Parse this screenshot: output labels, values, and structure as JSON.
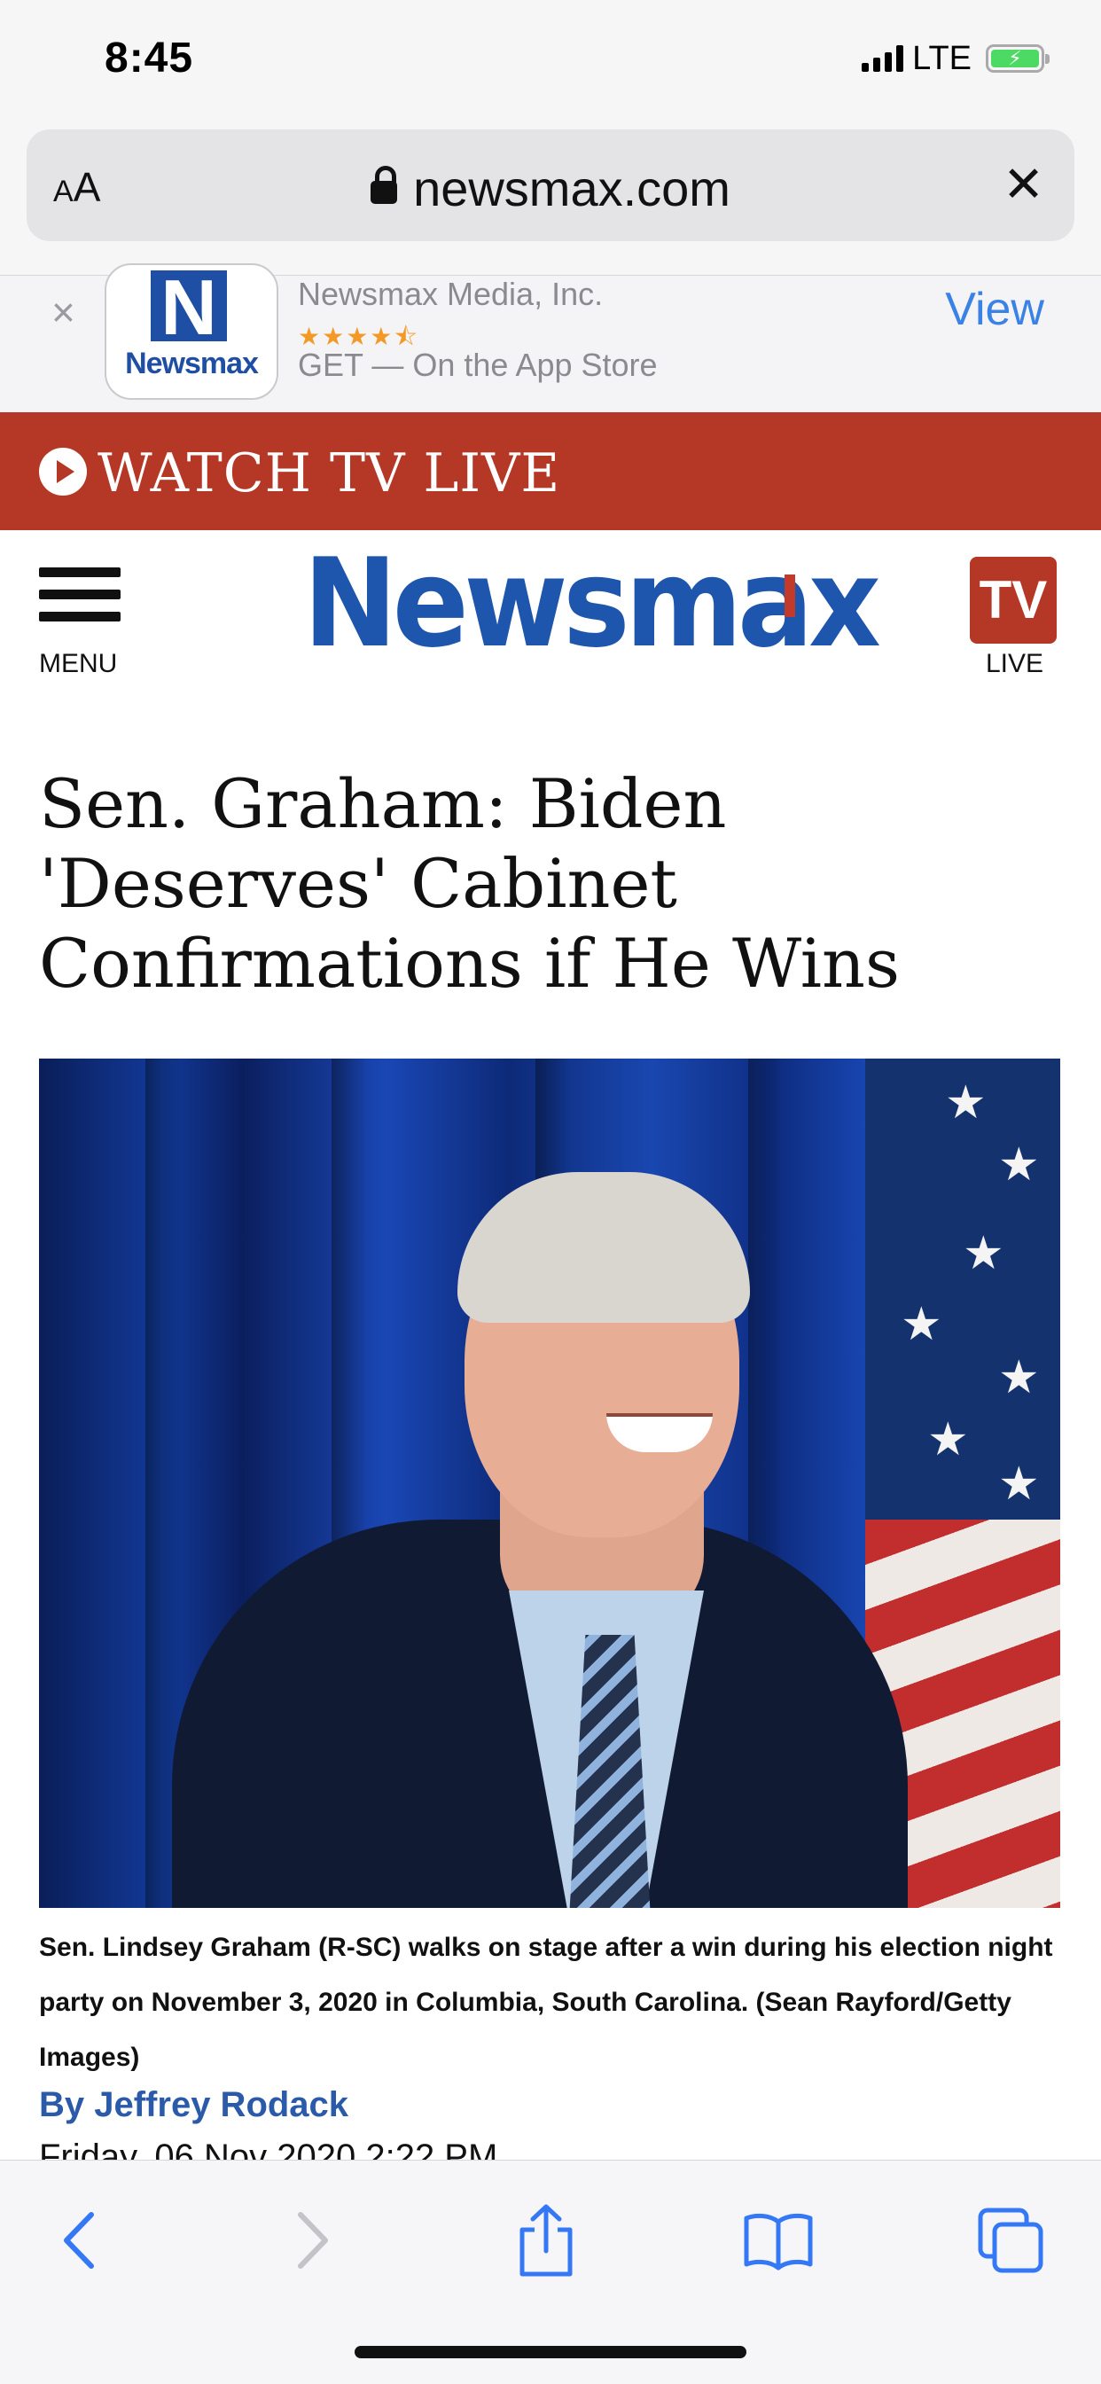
{
  "status_bar": {
    "time": "8:45",
    "network": "LTE"
  },
  "browser": {
    "text_size_label": "AA",
    "domain": "newsmax.com"
  },
  "app_banner": {
    "app_name": "Newsmax Media, Inc.",
    "rating_stars": "★★★★⯪",
    "get_text": "GET — On the App Store",
    "view_label": "View",
    "logo_letter": "N",
    "logo_word": "Newsmax"
  },
  "watch_bar": {
    "label": "WATCH TV LIVE",
    "color": "#b53826"
  },
  "site_header": {
    "menu_label": "MENU",
    "logo_text": "Newsmax",
    "tv_badge": "TV",
    "live_label": "LIVE",
    "brand_color": "#1e55ad"
  },
  "article": {
    "headline": "Sen. Graham: Biden 'Deserves' Cabinet Confirmations if He Wins",
    "caption": "Sen. Lindsey Graham (R-SC) walks on stage after a win during his election night party on November 3, 2020 in Columbia, South Carolina. (Sean Rayford/Getty Images)",
    "byline": "By Jeffrey Rodack",
    "date": "Friday, 06 Nov 2020 2:22 PM"
  },
  "toolbar": {
    "icons": [
      "back-icon",
      "forward-icon",
      "share-icon",
      "bookmarks-icon",
      "tabs-icon"
    ],
    "accent": "#3478f6"
  }
}
